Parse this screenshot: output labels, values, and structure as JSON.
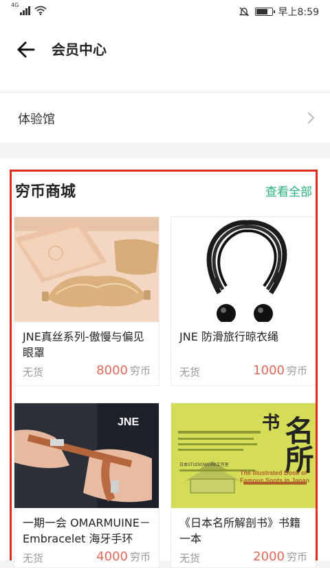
{
  "status_bar": {
    "network": "4G",
    "time": "早上8:59"
  },
  "header": {
    "title": "会员中心"
  },
  "experience": {
    "label": "体验馆"
  },
  "shop": {
    "title": "穷币商城",
    "view_all": "查看全部",
    "products": [
      {
        "name": "JNE真丝系列-傲慢与偏见眼罩",
        "stock": "无货",
        "price": "8000",
        "unit": "穷币"
      },
      {
        "name": "JNE 防滑旅行晾衣绳",
        "stock": "无货",
        "price": "1000",
        "unit": "穷币"
      },
      {
        "name": "一期一会 OMARMUINE－Embracelet 海牙手环",
        "stock": "无货",
        "price": "4000",
        "unit": "穷币"
      },
      {
        "name": "《日本名所解剖书》书籍一本",
        "stock": "无货",
        "price": "2000",
        "unit": "穷币"
      }
    ]
  },
  "book_cover": {
    "title_chars": "名所",
    "title_partial": "书",
    "publisher": "日本STUDIOWORK工作室",
    "english_title": "The Illustrated Book of Famous Spots in Japan"
  },
  "colors": {
    "accent": "#27b07a",
    "price": "#e0685a",
    "highlight": "#e02a1d"
  }
}
